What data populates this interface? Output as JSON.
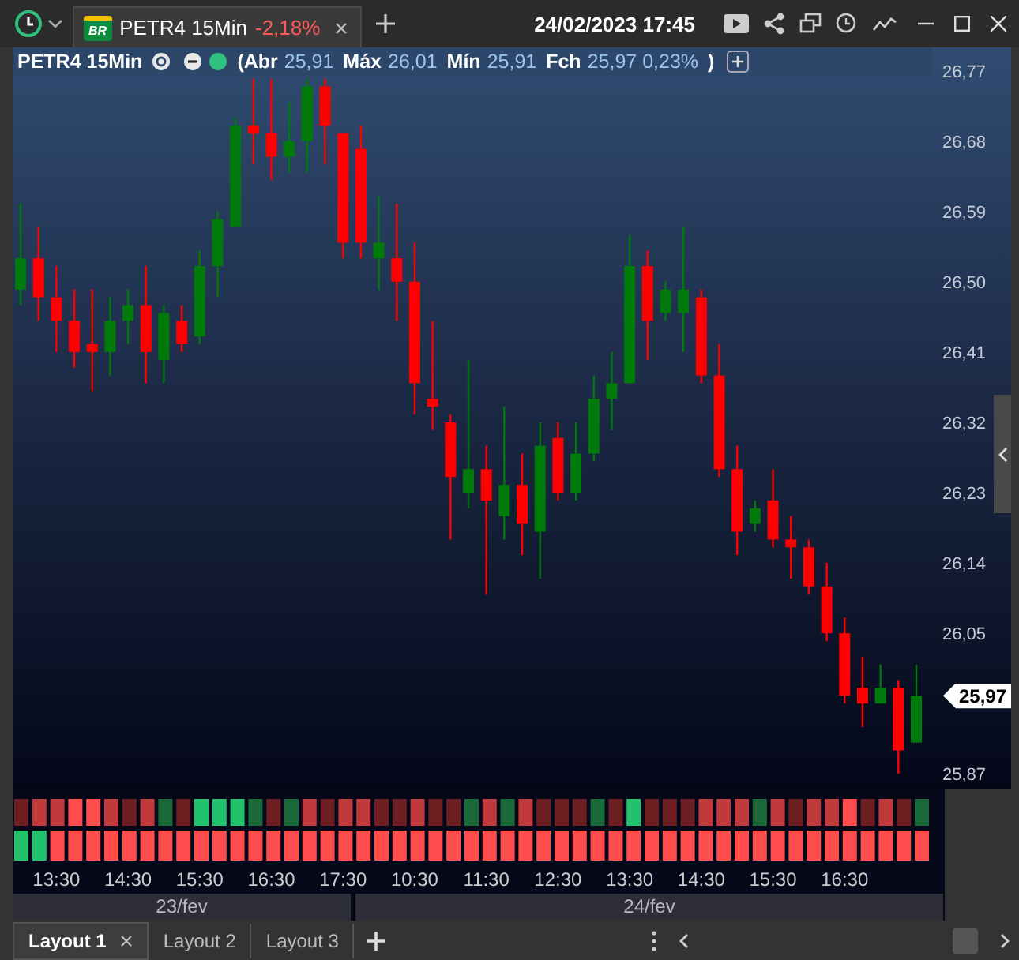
{
  "toolbar": {
    "date_time": "24/02/2023 17:45"
  },
  "tabs": [
    {
      "logo": "BR",
      "title": "PETR4 15Min",
      "change": "-2,18%",
      "selected": true
    }
  ],
  "chart": {
    "title": "PETR4 15Min",
    "quote": [
      {
        "label": "(Abr",
        "value": "25,91"
      },
      {
        "label": "Máx",
        "value": "26,01"
      },
      {
        "label": "Mín",
        "value": "25,91"
      },
      {
        "label": "Fch",
        "value": "25,97 0,23%"
      }
    ],
    "quote_end": ")",
    "last_price": "25,97",
    "chart_data": {
      "type": "candlestick",
      "ylim": [
        25.85,
        26.8
      ],
      "categories": [
        null,
        null,
        "13:30",
        null,
        null,
        null,
        "14:30",
        null,
        null,
        null,
        "15:30",
        null,
        null,
        null,
        "16:30",
        null,
        null,
        null,
        "17:30",
        null,
        null,
        null,
        "10:30",
        null,
        null,
        null,
        "11:30",
        null,
        null,
        null,
        "12:30",
        null,
        null,
        null,
        "13:30",
        null,
        null,
        null,
        "14:30",
        null,
        null,
        null,
        "15:30",
        null,
        null,
        null,
        "16:30",
        null,
        null,
        null,
        null
      ],
      "ohlc": [
        [
          26.49,
          26.6,
          26.47,
          26.53
        ],
        [
          26.53,
          26.57,
          26.45,
          26.48
        ],
        [
          26.48,
          26.52,
          26.41,
          26.45
        ],
        [
          26.45,
          26.49,
          26.39,
          26.41
        ],
        [
          26.42,
          26.49,
          26.36,
          26.41
        ],
        [
          26.41,
          26.48,
          26.38,
          26.45
        ],
        [
          26.45,
          26.49,
          26.42,
          26.47
        ],
        [
          26.47,
          26.52,
          26.37,
          26.41
        ],
        [
          26.4,
          26.47,
          26.37,
          26.46
        ],
        [
          26.45,
          26.47,
          26.41,
          26.42
        ],
        [
          26.43,
          26.54,
          26.42,
          26.52
        ],
        [
          26.52,
          26.59,
          26.48,
          26.58
        ],
        [
          26.57,
          26.71,
          26.57,
          26.7
        ],
        [
          26.7,
          26.76,
          26.65,
          26.69
        ],
        [
          26.69,
          26.76,
          26.63,
          26.66
        ],
        [
          26.66,
          26.73,
          26.64,
          26.68
        ],
        [
          26.68,
          26.76,
          26.64,
          26.75
        ],
        [
          26.75,
          26.76,
          26.65,
          26.7
        ],
        [
          26.69,
          26.69,
          26.53,
          26.55
        ],
        [
          26.67,
          26.7,
          26.53,
          26.55
        ],
        [
          26.53,
          26.61,
          26.49,
          26.55
        ],
        [
          26.53,
          26.6,
          26.45,
          26.5
        ],
        [
          26.5,
          26.55,
          26.33,
          26.37
        ],
        [
          26.35,
          26.45,
          26.31,
          26.34
        ],
        [
          26.32,
          26.33,
          26.17,
          26.25
        ],
        [
          26.23,
          26.4,
          26.21,
          26.26
        ],
        [
          26.26,
          26.29,
          26.1,
          26.22
        ],
        [
          26.2,
          26.34,
          26.17,
          26.24
        ],
        [
          26.24,
          26.28,
          26.15,
          26.19
        ],
        [
          26.18,
          26.32,
          26.12,
          26.29
        ],
        [
          26.3,
          26.32,
          26.22,
          26.23
        ],
        [
          26.23,
          26.32,
          26.22,
          26.28
        ],
        [
          26.28,
          26.38,
          26.27,
          26.35
        ],
        [
          26.35,
          26.41,
          26.31,
          26.37
        ],
        [
          26.37,
          26.56,
          26.37,
          26.52
        ],
        [
          26.52,
          26.54,
          26.4,
          26.45
        ],
        [
          26.46,
          26.5,
          26.45,
          26.49
        ],
        [
          26.46,
          26.57,
          26.41,
          26.49
        ],
        [
          26.48,
          26.49,
          26.37,
          26.38
        ],
        [
          26.38,
          26.42,
          26.25,
          26.26
        ],
        [
          26.26,
          26.29,
          26.15,
          26.18
        ],
        [
          26.19,
          26.22,
          26.18,
          26.21
        ],
        [
          26.22,
          26.26,
          26.16,
          26.17
        ],
        [
          26.17,
          26.2,
          26.12,
          26.16
        ],
        [
          26.16,
          26.17,
          26.1,
          26.11
        ],
        [
          26.11,
          26.14,
          26.04,
          26.05
        ],
        [
          26.05,
          26.07,
          25.96,
          25.97
        ],
        [
          25.98,
          26.02,
          25.93,
          25.96
        ],
        [
          25.96,
          26.01,
          25.96,
          25.98
        ],
        [
          25.98,
          25.99,
          25.87,
          25.9
        ],
        [
          25.91,
          26.01,
          25.91,
          25.97
        ]
      ],
      "yticks": [
        {
          "value": 26.77,
          "label": "26,77"
        },
        {
          "value": 26.68,
          "label": "26,68"
        },
        {
          "value": 26.59,
          "label": "26,59"
        },
        {
          "value": 26.5,
          "label": "26,50"
        },
        {
          "value": 26.41,
          "label": "26,41"
        },
        {
          "value": 26.32,
          "label": "26,32"
        },
        {
          "value": 26.23,
          "label": "26,23"
        },
        {
          "value": 26.14,
          "label": "26,14"
        },
        {
          "value": 26.05,
          "label": "26,05"
        },
        {
          "value": 25.87,
          "label": "25,87"
        }
      ]
    }
  },
  "indicator": {
    "top": [
      {
        "color": "#6e1f22"
      },
      {
        "color": "#c0393b"
      },
      {
        "color": "#c0393b"
      },
      {
        "color": "#ff4d4d"
      },
      {
        "color": "#ff4d4d"
      },
      {
        "color": "#c0393b"
      },
      {
        "color": "#6e1f22"
      },
      {
        "color": "#c0393b"
      },
      {
        "color": "#1b6b3a"
      },
      {
        "color": "#6e1f22"
      },
      {
        "color": "#21c26b"
      },
      {
        "color": "#21c26b"
      },
      {
        "color": "#21c26b"
      },
      {
        "color": "#1b6b3a"
      },
      {
        "color": "#6e1f22"
      },
      {
        "color": "#1b6b3a"
      },
      {
        "color": "#c0393b"
      },
      {
        "color": "#6e1f22"
      },
      {
        "color": "#c0393b"
      },
      {
        "color": "#c0393b"
      },
      {
        "color": "#6e1f22"
      },
      {
        "color": "#6e1f22"
      },
      {
        "color": "#c0393b"
      },
      {
        "color": "#6e1f22"
      },
      {
        "color": "#6e1f22"
      },
      {
        "color": "#1b6b3a"
      },
      {
        "color": "#c0393b"
      },
      {
        "color": "#1b6b3a"
      },
      {
        "color": "#c0393b"
      },
      {
        "color": "#6e1f22"
      },
      {
        "color": "#6e1f22"
      },
      {
        "color": "#6e1f22"
      },
      {
        "color": "#1b6b3a"
      },
      {
        "color": "#6e1f22"
      },
      {
        "color": "#21c26b"
      },
      {
        "color": "#6e1f22"
      },
      {
        "color": "#6e1f22"
      },
      {
        "color": "#6e1f22"
      },
      {
        "color": "#c0393b"
      },
      {
        "color": "#c0393b"
      },
      {
        "color": "#c0393b"
      },
      {
        "color": "#1b6b3a"
      },
      {
        "color": "#c0393b"
      },
      {
        "color": "#6e1f22"
      },
      {
        "color": "#c0393b"
      },
      {
        "color": "#c0393b"
      },
      {
        "color": "#ff4d4d"
      },
      {
        "color": "#6e1f22"
      },
      {
        "color": "#c0393b"
      },
      {
        "color": "#6e1f22"
      },
      {
        "color": "#1b6b3a"
      }
    ],
    "bottom": [
      {
        "color": "#21c26b"
      },
      {
        "color": "#21c26b"
      },
      {
        "color": "#ff4d4d"
      },
      {
        "color": "#ff4d4d"
      },
      {
        "color": "#ff4d4d"
      },
      {
        "color": "#ff4d4d"
      },
      {
        "color": "#ff4d4d"
      },
      {
        "color": "#ff4d4d"
      },
      {
        "color": "#ff4d4d"
      },
      {
        "color": "#ff4d4d"
      },
      {
        "color": "#ff4d4d"
      },
      {
        "color": "#ff4d4d"
      },
      {
        "color": "#ff4d4d"
      },
      {
        "color": "#ff4d4d"
      },
      {
        "color": "#ff4d4d"
      },
      {
        "color": "#ff4d4d"
      },
      {
        "color": "#ff4d4d"
      },
      {
        "color": "#ff4d4d"
      },
      {
        "color": "#ff4d4d"
      },
      {
        "color": "#ff4d4d"
      },
      {
        "color": "#ff4d4d"
      },
      {
        "color": "#ff4d4d"
      },
      {
        "color": "#ff4d4d"
      },
      {
        "color": "#ff4d4d"
      },
      {
        "color": "#ff4d4d"
      },
      {
        "color": "#ff4d4d"
      },
      {
        "color": "#ff4d4d"
      },
      {
        "color": "#ff4d4d"
      },
      {
        "color": "#ff4d4d"
      },
      {
        "color": "#ff4d4d"
      },
      {
        "color": "#ff4d4d"
      },
      {
        "color": "#ff4d4d"
      },
      {
        "color": "#ff4d4d"
      },
      {
        "color": "#ff4d4d"
      },
      {
        "color": "#ff4d4d"
      },
      {
        "color": "#ff4d4d"
      },
      {
        "color": "#ff4d4d"
      },
      {
        "color": "#ff4d4d"
      },
      {
        "color": "#ff4d4d"
      },
      {
        "color": "#ff4d4d"
      },
      {
        "color": "#ff4d4d"
      },
      {
        "color": "#ff4d4d"
      },
      {
        "color": "#ff4d4d"
      },
      {
        "color": "#ff4d4d"
      },
      {
        "color": "#ff4d4d"
      },
      {
        "color": "#ff4d4d"
      },
      {
        "color": "#ff4d4d"
      },
      {
        "color": "#ff4d4d"
      },
      {
        "color": "#ff4d4d"
      },
      {
        "color": "#ff4d4d"
      },
      {
        "color": "#ff4d4d"
      }
    ]
  },
  "dates": [
    "23/fev",
    "24/fev"
  ],
  "layouts": [
    {
      "label": "Layout 1",
      "selected": true
    },
    {
      "label": "Layout 2",
      "selected": false
    },
    {
      "label": "Layout 3",
      "selected": false
    }
  ]
}
